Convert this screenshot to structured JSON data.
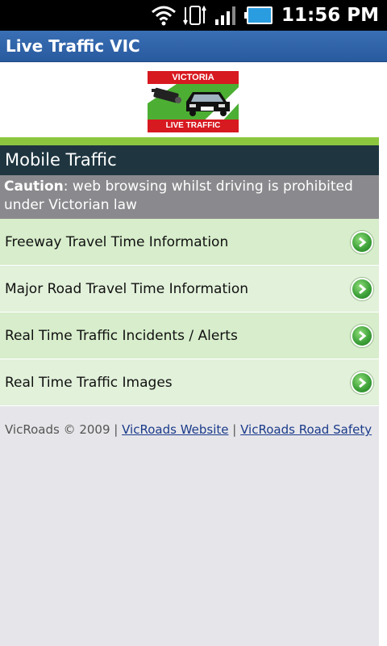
{
  "status_bar": {
    "time": "11:56 PM"
  },
  "app": {
    "title": "Live Traffic VIC"
  },
  "logo": {
    "top_text": "VICTORIA",
    "bottom_text": "LIVE TRAFFIC"
  },
  "section": {
    "title": "Mobile Traffic"
  },
  "caution": {
    "label": "Caution",
    "text": ": web browsing whilst driving is prohibited under Victorian law"
  },
  "menu": [
    {
      "label": "Freeway Travel Time Information"
    },
    {
      "label": "Major Road Travel Time Information"
    },
    {
      "label": "Real Time Traffic Incidents / Alerts"
    },
    {
      "label": "Real Time Traffic Images"
    }
  ],
  "footer": {
    "copyright": "VicRoads © 2009 |",
    "separator": "|",
    "link1": "VicRoads Website",
    "link2": "VicRoads Road Safety"
  },
  "colors": {
    "accent_green": "#8cc63f",
    "header_bg": "#1f3641",
    "title_bar": "#285a9e"
  }
}
